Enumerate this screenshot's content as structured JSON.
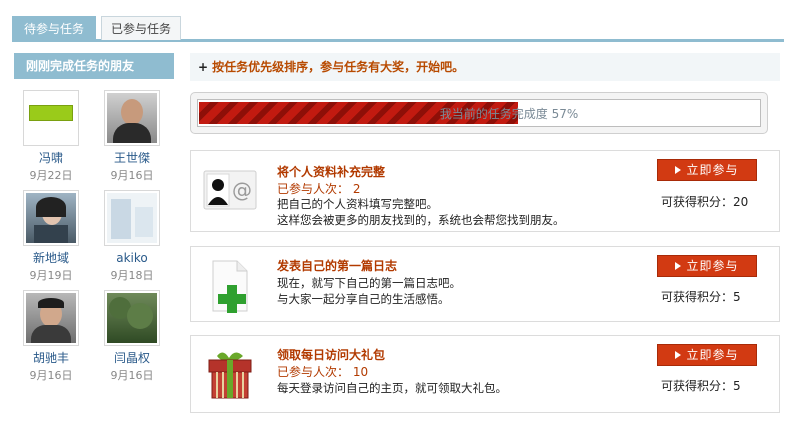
{
  "tabs": [
    {
      "label": "待参与任务",
      "active": true
    },
    {
      "label": "已参与任务",
      "active": false
    }
  ],
  "sidebar": {
    "title": "刚刚完成任务的朋友",
    "friends": [
      {
        "name": "冯啸",
        "date": "9月22日"
      },
      {
        "name": "王世傑",
        "date": "9月16日"
      },
      {
        "name": "新地域",
        "date": "9月19日"
      },
      {
        "name": "akiko",
        "date": "9月18日"
      },
      {
        "name": "胡驰丰",
        "date": "9月16日"
      },
      {
        "name": "闫晶权",
        "date": "9月16日"
      }
    ]
  },
  "header_bar": {
    "plus": "+",
    "text": "按任务优先级排序，参与任务有大奖，开始吧。"
  },
  "progress": {
    "label": "我当前的任务完成度",
    "percent_text": "57%",
    "value": 0.57,
    "fill_color": "#c21a10"
  },
  "tasks": [
    {
      "title": "将个人资料补充完整",
      "participants": "已参与人次： 2",
      "desc": [
        "把自己的个人资料填写完整吧。",
        "这样您会被更多的朋友找到的，系统也会帮您找到朋友。"
      ],
      "button": "立即参与",
      "points": "可获得积分：20",
      "icon": "profile-card-icon"
    },
    {
      "title": "发表自己的第一篇日志",
      "participants": "",
      "desc": [
        "现在，就写下自己的第一篇日志吧。",
        "与大家一起分享自己的生活感悟。"
      ],
      "button": "立即参与",
      "points": "可获得积分：5",
      "icon": "new-document-icon"
    },
    {
      "title": "领取每日访问大礼包",
      "participants": "已参与人次： 10",
      "desc": [
        "每天登录访问自己的主页，就可领取大礼包。"
      ],
      "button": "立即参与",
      "points": "可获得积分：5",
      "icon": "gift-box-icon"
    }
  ],
  "colors": {
    "accent": "#8fbcd0",
    "title_orange": "#b23a00",
    "button_red": "#d23a12"
  }
}
